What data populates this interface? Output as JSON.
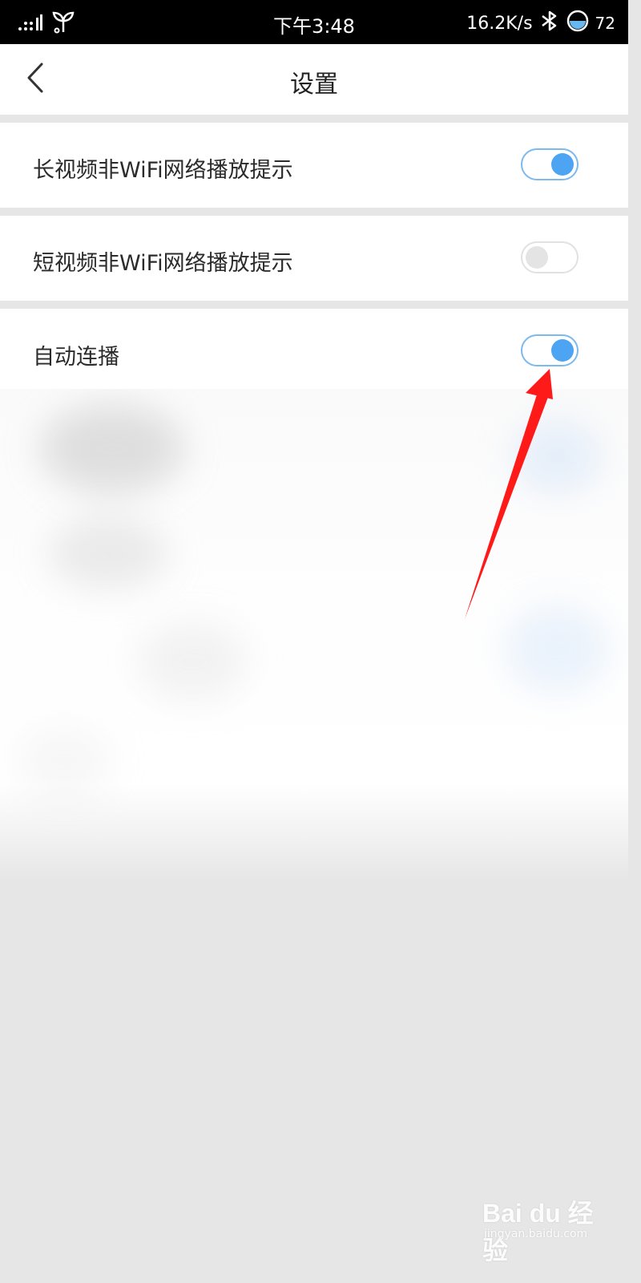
{
  "status_bar": {
    "time": "下午3:48",
    "network_speed": "16.2K/s",
    "battery_percent": "72",
    "icons": [
      "signal-icon",
      "sprout-icon",
      "bluetooth-icon",
      "battery-icon"
    ]
  },
  "title_bar": {
    "title": "设置",
    "back_icon": "chevron-left-icon"
  },
  "settings": [
    {
      "label": "长视频非WiFi网络播放提示",
      "enabled": true
    },
    {
      "label": "短视频非WiFi网络播放提示",
      "enabled": false
    },
    {
      "label": "自动连播",
      "enabled": true
    }
  ],
  "colors": {
    "toggle_on": "#4da4f2",
    "toggle_off": "#e4e4e4",
    "annotation_arrow": "#ff1a1a",
    "background": "#e6e6e6"
  },
  "watermark": {
    "brand": "Bai du 经验",
    "url": "jingyan.baidu.com"
  }
}
